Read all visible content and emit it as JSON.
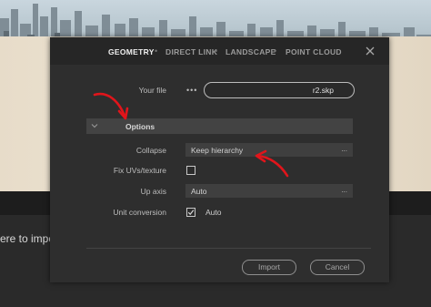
{
  "background": {
    "partial_text": "ere to impo"
  },
  "dialog": {
    "tabs": [
      {
        "label": "GEOMETRY",
        "active": true
      },
      {
        "label": "DIRECT LINK",
        "active": false
      },
      {
        "label": "LANDSCAPE",
        "active": false
      },
      {
        "label": "POINT CLOUD",
        "active": false
      }
    ],
    "tab_separator": "•",
    "close_icon": "close-icon",
    "your_file_label": "Your file",
    "file_browse_dots": "•••",
    "file_value": "r2.skp",
    "options_title": "Options",
    "collapse_label": "Collapse",
    "collapse_value": "Keep hierarchy",
    "select_more": "...",
    "fix_uvs_label": "Fix UVs/texture",
    "fix_uvs_checked": false,
    "up_axis_label": "Up axis",
    "up_axis_value": "Auto",
    "unit_conversion_label": "Unit conversion",
    "unit_conversion_checked": true,
    "unit_conversion_value": "Auto",
    "import_label": "Import",
    "cancel_label": "Cancel"
  },
  "colors": {
    "annotation_arrow": "#e0151b",
    "dialog_bg": "#2e2e2e"
  }
}
